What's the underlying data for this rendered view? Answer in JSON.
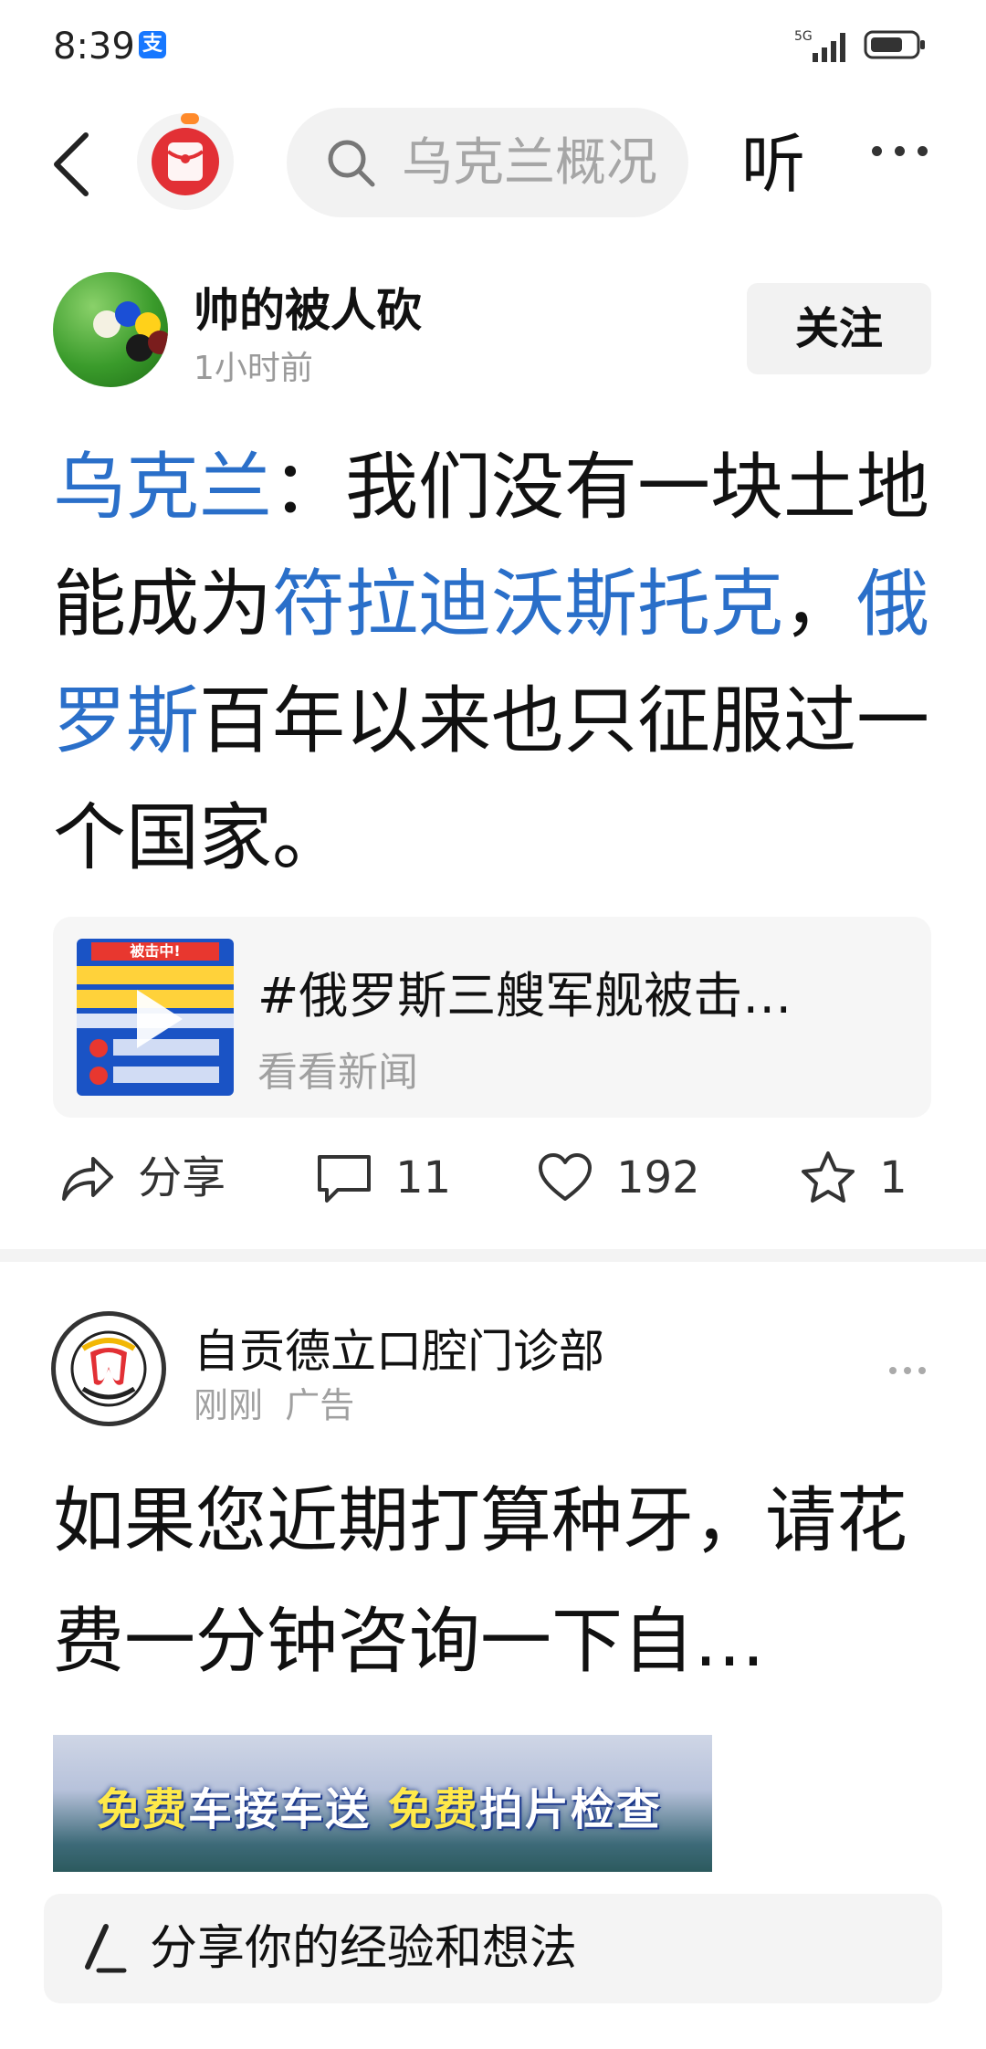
{
  "status": {
    "time": "8:39",
    "network": "5G",
    "alipay_badge": "支"
  },
  "nav": {
    "search_placeholder": "乌克兰概况",
    "listen": "听"
  },
  "post1": {
    "author": "帅的被人砍",
    "time": "1小时前",
    "follow": "关注",
    "text_segments": [
      {
        "t": "乌克兰",
        "hl": true
      },
      {
        "t": "：我们没有一块土地能成为",
        "hl": false
      },
      {
        "t": "符拉迪沃斯托克",
        "hl": true
      },
      {
        "t": "，",
        "hl": false
      },
      {
        "t": "俄罗斯",
        "hl": true
      },
      {
        "t": "百年以来也只征服过一个国家。",
        "hl": false
      }
    ],
    "card": {
      "title": "#俄罗斯三艘军舰被击…",
      "subtitle": "看看新闻",
      "thumb_caption": "被击中!"
    },
    "actions": {
      "share": "分享",
      "comments": "11",
      "likes": "192",
      "favorites": "1"
    }
  },
  "post2": {
    "author": "自贡德立口腔门诊部",
    "time": "刚刚",
    "ad_label": "广告",
    "text": "如果您近期打算种牙，请花费一分钟咨询一下自…",
    "banner_segments": [
      {
        "t": "免费",
        "y": true
      },
      {
        "t": "车接车送 ",
        "y": false
      },
      {
        "t": "免费",
        "y": true
      },
      {
        "t": "拍片检查",
        "y": false
      }
    ]
  },
  "compose": {
    "placeholder": "分享你的经验和想法"
  },
  "colors": {
    "link": "#2a6fc9",
    "background": "#ffffff"
  }
}
